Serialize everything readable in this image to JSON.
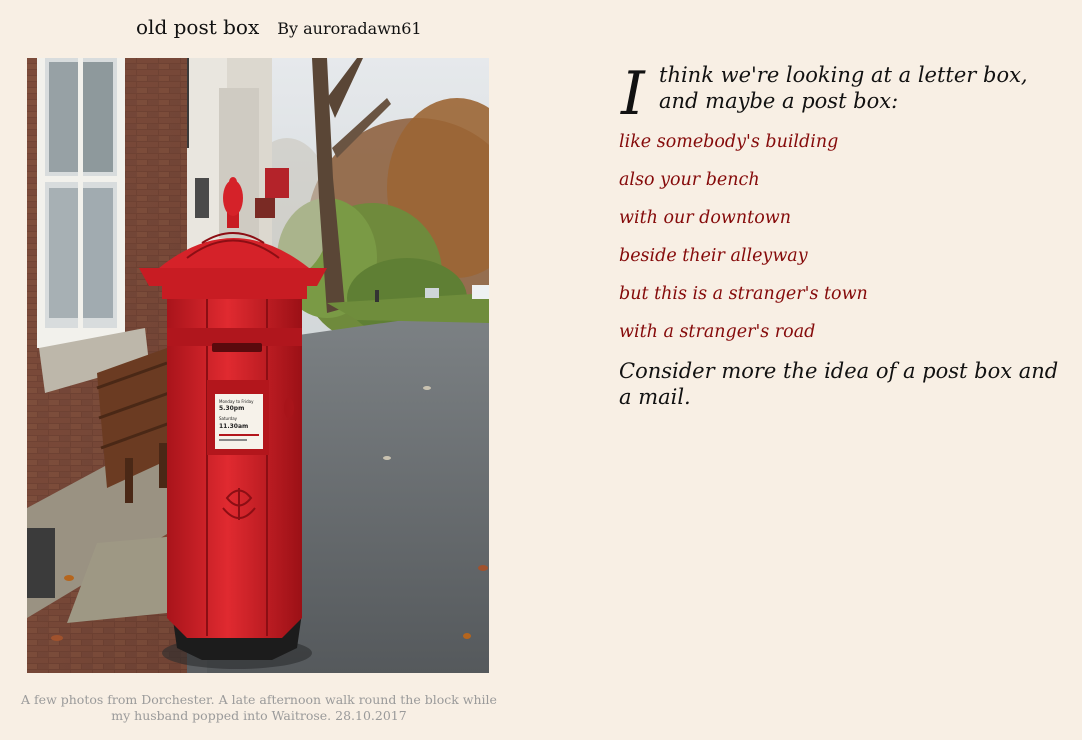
{
  "header": {
    "title": "old post box",
    "author": "By auroradawn61"
  },
  "photo": {
    "caption": "A few photos from Dorchester. A late afternoon walk round the block while my husband popped into Waitrose. 28.10.2017",
    "post_box_plate": {
      "line1": "Monday to Friday",
      "line2": "5.30pm",
      "line3": "Saturday",
      "line4": "11.30am"
    }
  },
  "poem": {
    "drop_cap": "I",
    "intro": "think we're looking at a letter box, and maybe a post box:",
    "lines": [
      "like somebody's building",
      "also your bench",
      "with our downtown",
      "beside their alleyway",
      "but this is a stranger's town",
      "with a stranger's road"
    ],
    "closing": "Consider more the idea of a post box and a mail."
  },
  "colors": {
    "background": "#f8efe4",
    "poem_line": "#850a0a",
    "caption": "#9a9a9a",
    "post_box_red": "#d01f26"
  }
}
